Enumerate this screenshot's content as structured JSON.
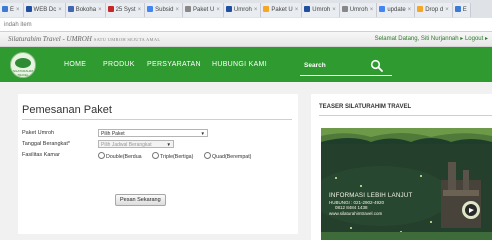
{
  "browser": {
    "tabs": [
      {
        "label": "Ε",
        "color": "#3b7bd6"
      },
      {
        "label": "WEB Dc",
        "color": "#1f4fa0"
      },
      {
        "label": "Bokoha",
        "color": "#4267b2"
      },
      {
        "label": "25 Syst",
        "color": "#c62828"
      },
      {
        "label": "Subsid",
        "color": "#4285f4"
      },
      {
        "label": "Paket U",
        "color": "#888888"
      },
      {
        "label": "Umroh",
        "color": "#1f4fa0"
      },
      {
        "label": "Paket U",
        "color": "#f5a623"
      },
      {
        "label": "Umroh",
        "color": "#1f4fa0"
      },
      {
        "label": "Umroh",
        "color": "#888888"
      },
      {
        "label": "update",
        "color": "#4285f4"
      },
      {
        "label": "Drop d",
        "color": "#f5a623"
      },
      {
        "label": "Ε",
        "color": "#3b7bd6"
      }
    ],
    "url": "indah item"
  },
  "header": {
    "site_title": "Silaturahim Travel - UMROH",
    "tagline": "SATU UMROH SEJUTA AMAL",
    "welcome": "Selamat Datang, Siti Nurjannah ▸ Logout ▸"
  },
  "nav": {
    "logo_text": "SILATURAHIM TRAVEL",
    "items": [
      "HOME",
      "PRODUK",
      "PERSYARATAN",
      "HUBUNGI KAMI"
    ],
    "search_placeholder": "Search"
  },
  "form": {
    "title": "Pemesanan Paket",
    "package_label": "Paket Umroh",
    "package_value": "Pilih Paket",
    "date_label": "Tanggal Berangkat*",
    "date_value": "Pilih Jadwal Berangkat",
    "room_label": "Fasilitas Kamar",
    "room_options": [
      "Double(Berdua",
      "Triple(Bertiga)",
      "Quad(Berempat)"
    ],
    "submit_label": "Pesan Sekarang"
  },
  "sidebar": {
    "title": "TEASER SILATURAHIM TRAVEL",
    "banner_heading": "INFORMASI LEBIH LANJUT",
    "banner_phone_1": "HUBUNGI : 021-2902-4920",
    "banner_phone_2": "0812 8484 1438",
    "banner_site": "www.silaturahimtravel.com"
  },
  "colors": {
    "nav_green": "#2f9a2f",
    "welcome_green": "#2d7a2d",
    "banner_dark": "#1f3d2b"
  }
}
